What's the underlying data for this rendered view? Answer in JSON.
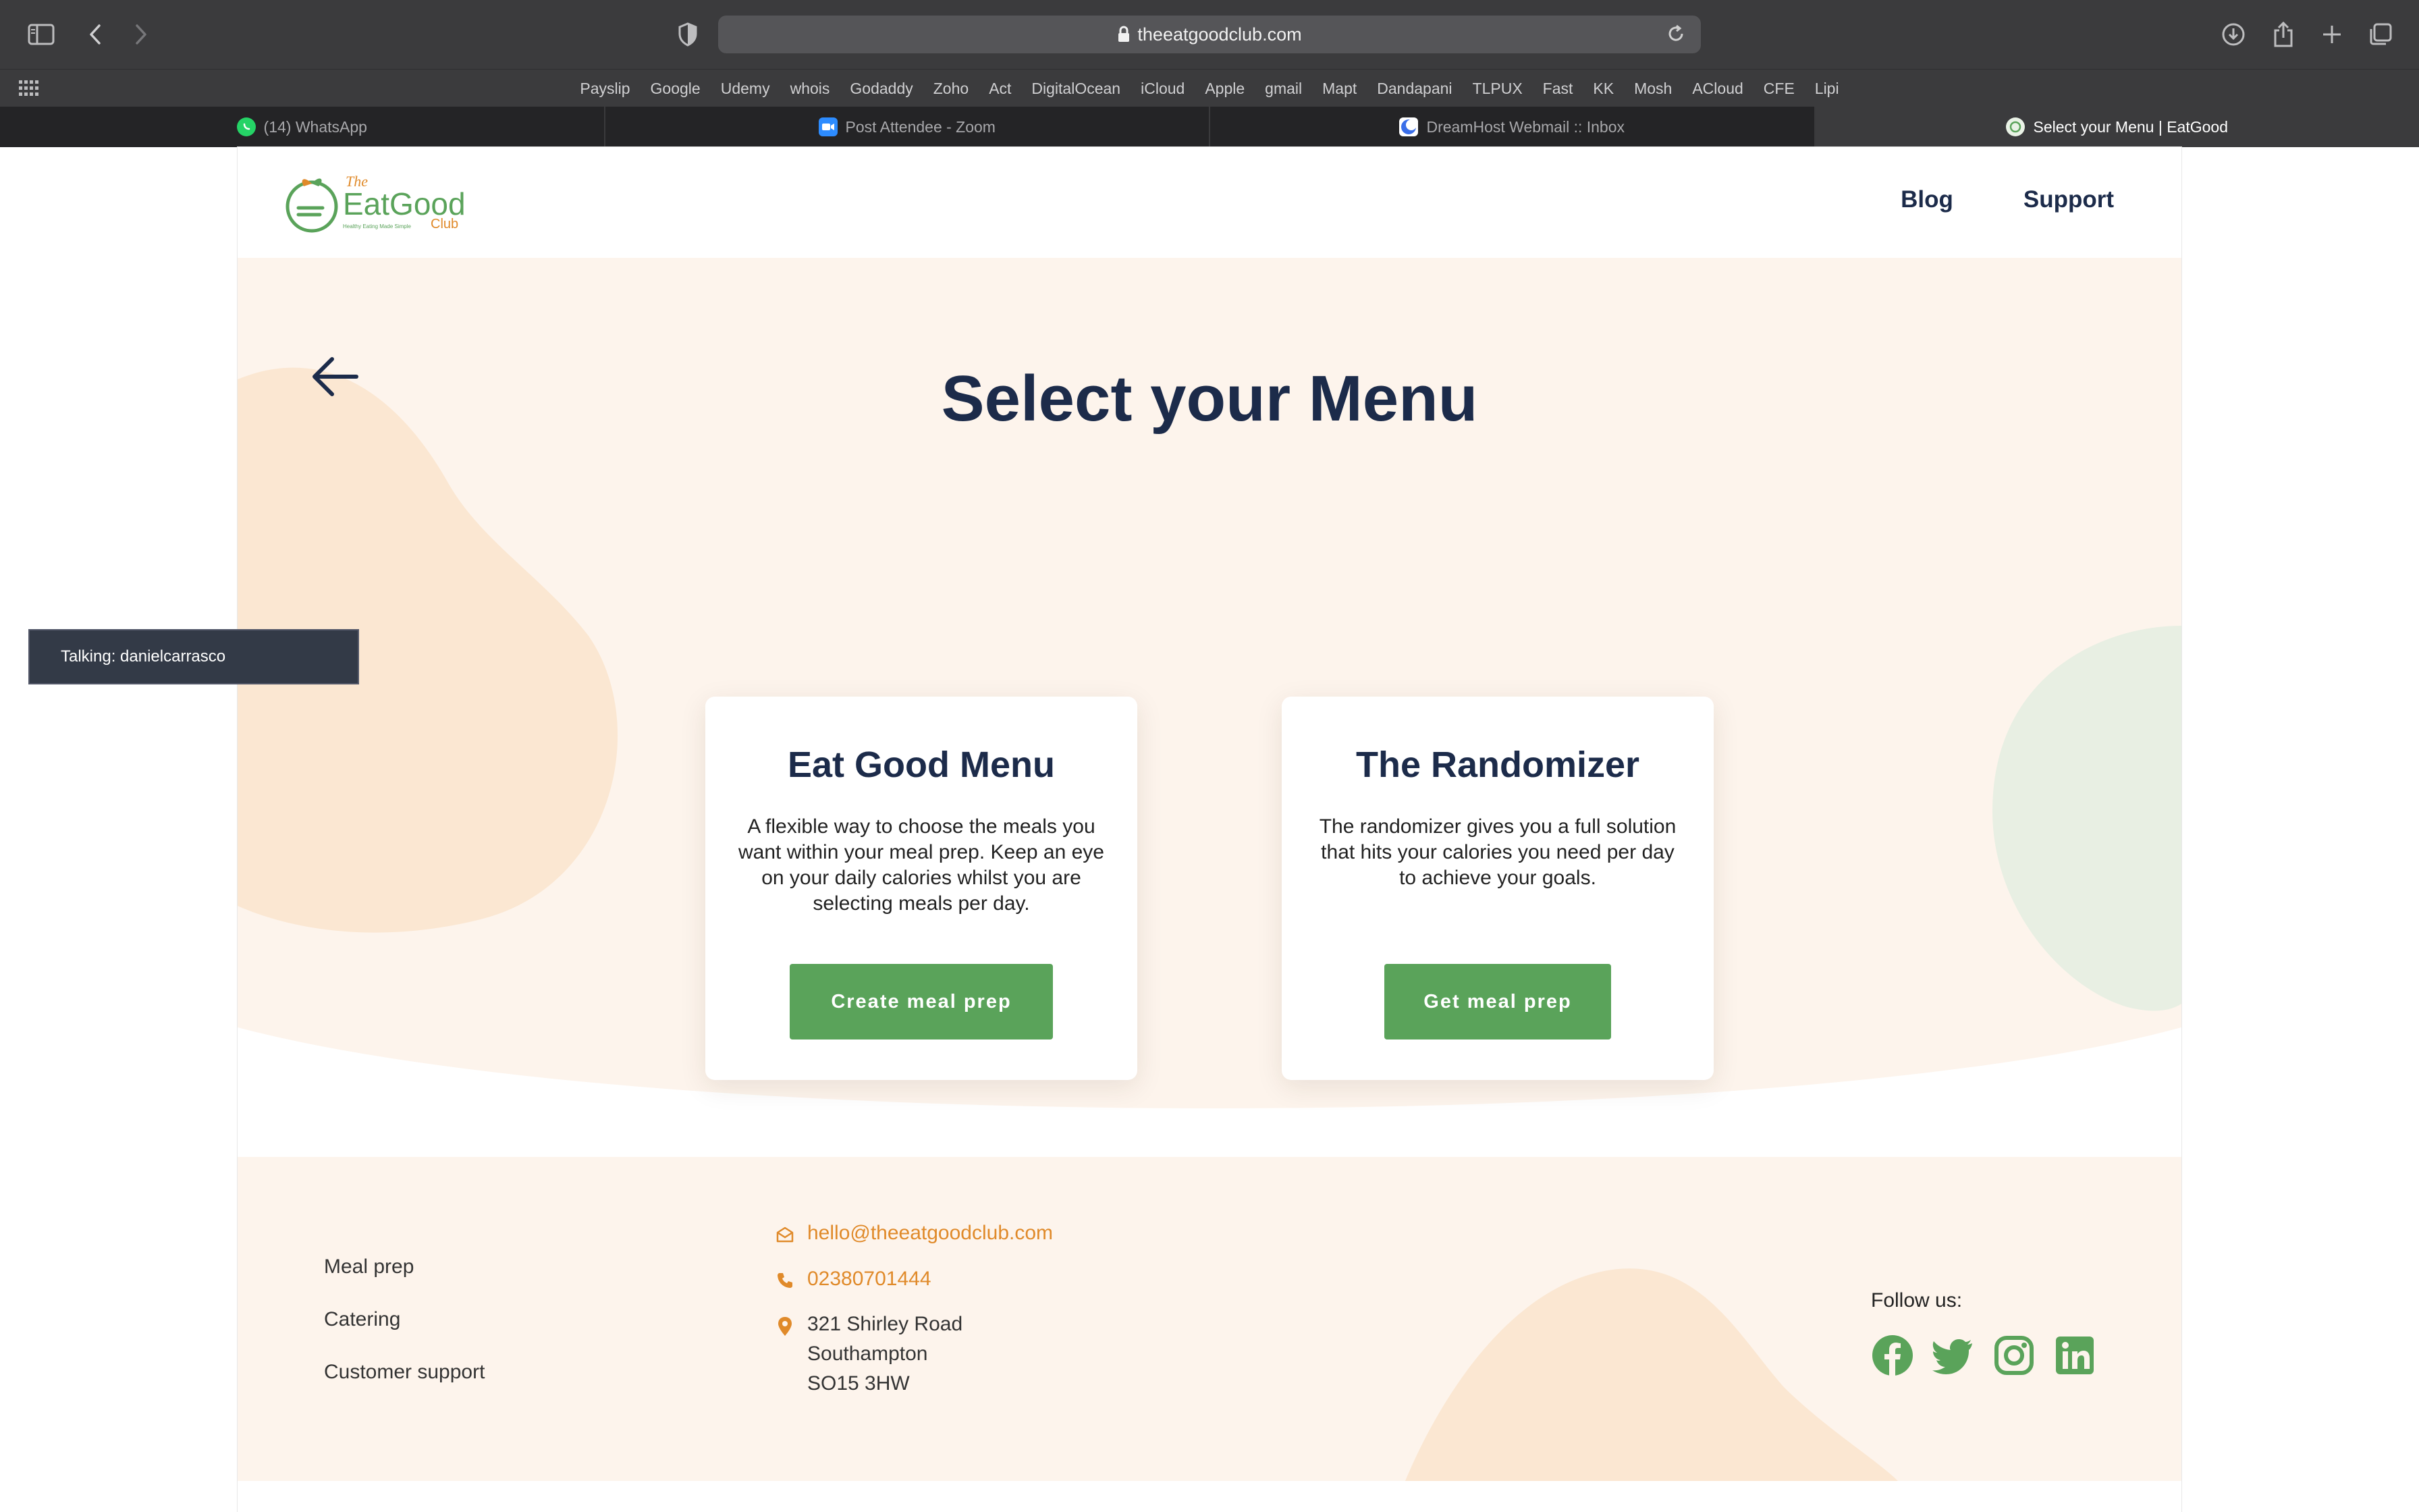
{
  "browser": {
    "url": "theeatgoodclub.com",
    "bookmarks": [
      "Payslip",
      "Google",
      "Udemy",
      "whois",
      "Godaddy",
      "Zoho",
      "Act",
      "DigitalOcean",
      "iCloud",
      "Apple",
      "gmail",
      "Mapt",
      "Dandapani",
      "TLPUX",
      "Fast",
      "KK",
      "Mosh",
      "ACloud",
      "CFE",
      "Lipi"
    ],
    "tabs": [
      {
        "label": "(14) WhatsApp",
        "icon": "whatsapp-icon",
        "color": "#25d366"
      },
      {
        "label": "Post Attendee - Zoom",
        "icon": "zoom-icon",
        "color": "#2d8cff"
      },
      {
        "label": "DreamHost Webmail :: Inbox",
        "icon": "dreamhost-icon",
        "color": "#3a6ee8"
      },
      {
        "label": "Select your Menu | EatGood",
        "icon": "eatgood-icon",
        "color": "#5aa35a",
        "active": true
      }
    ]
  },
  "header": {
    "logo": {
      "small": "The",
      "brand": "EatGood",
      "sub": "Club",
      "tagline": "Healthy Eating Made Simple"
    },
    "nav": [
      "Blog",
      "Support"
    ]
  },
  "hero": {
    "title": "Select your Menu",
    "cards": [
      {
        "title": "Eat Good Menu",
        "text": "A flexible way to choose the meals you want within your meal prep. Keep an eye on your daily calories whilst you are selecting meals per day.",
        "button": "Create meal prep"
      },
      {
        "title": "The Randomizer",
        "text": "The randomizer gives you a full solution that hits your calories you need per day to achieve your goals.",
        "button": "Get meal prep"
      }
    ]
  },
  "footer": {
    "links": [
      "Meal prep",
      "Catering",
      "Customer support"
    ],
    "email": "hello@theeatgoodclub.com",
    "phone": "02380701444",
    "address": [
      "321 Shirley Road",
      "Southampton",
      "SO15 3HW"
    ],
    "follow_label": "Follow us:",
    "socials": [
      "facebook-icon",
      "twitter-icon",
      "instagram-icon",
      "linkedin-icon"
    ]
  },
  "overlay": {
    "talking": "Talking: danielcarrasco"
  },
  "colors": {
    "brand_green": "#5aa35a",
    "accent_orange": "#e08a2a",
    "navy": "#1c2b4a",
    "cream": "#fdf4ec"
  }
}
